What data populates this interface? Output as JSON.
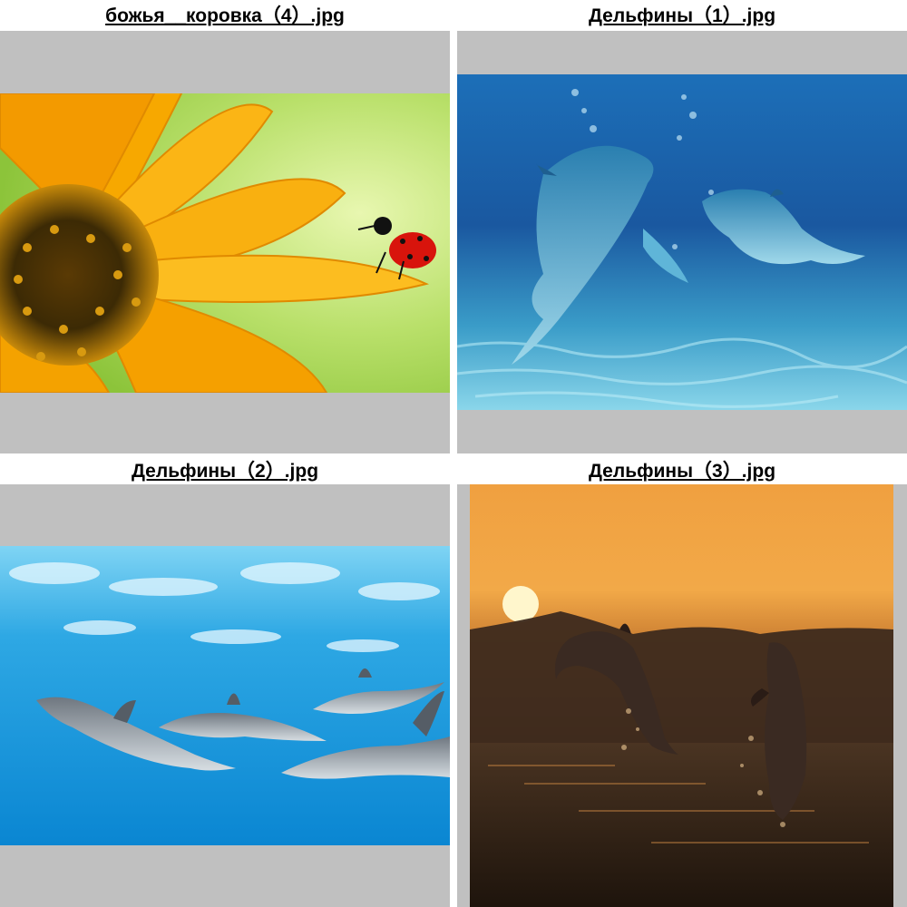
{
  "tiles": [
    {
      "caption": "божья__коровка（4）.jpg",
      "scene": "sunflower with ladybug"
    },
    {
      "caption": "Дельфины（1）.jpg",
      "scene": "two illustrated dolphins underwater"
    },
    {
      "caption": "Дельфины（2）.jpg",
      "scene": "group of dolphins under the water surface"
    },
    {
      "caption": "Дельфины（3）.jpg",
      "scene": "two dolphins jumping at sunset"
    }
  ],
  "colors": {
    "frame": "#c0c0c0",
    "background": "#ffffff",
    "caption": "#000000"
  }
}
